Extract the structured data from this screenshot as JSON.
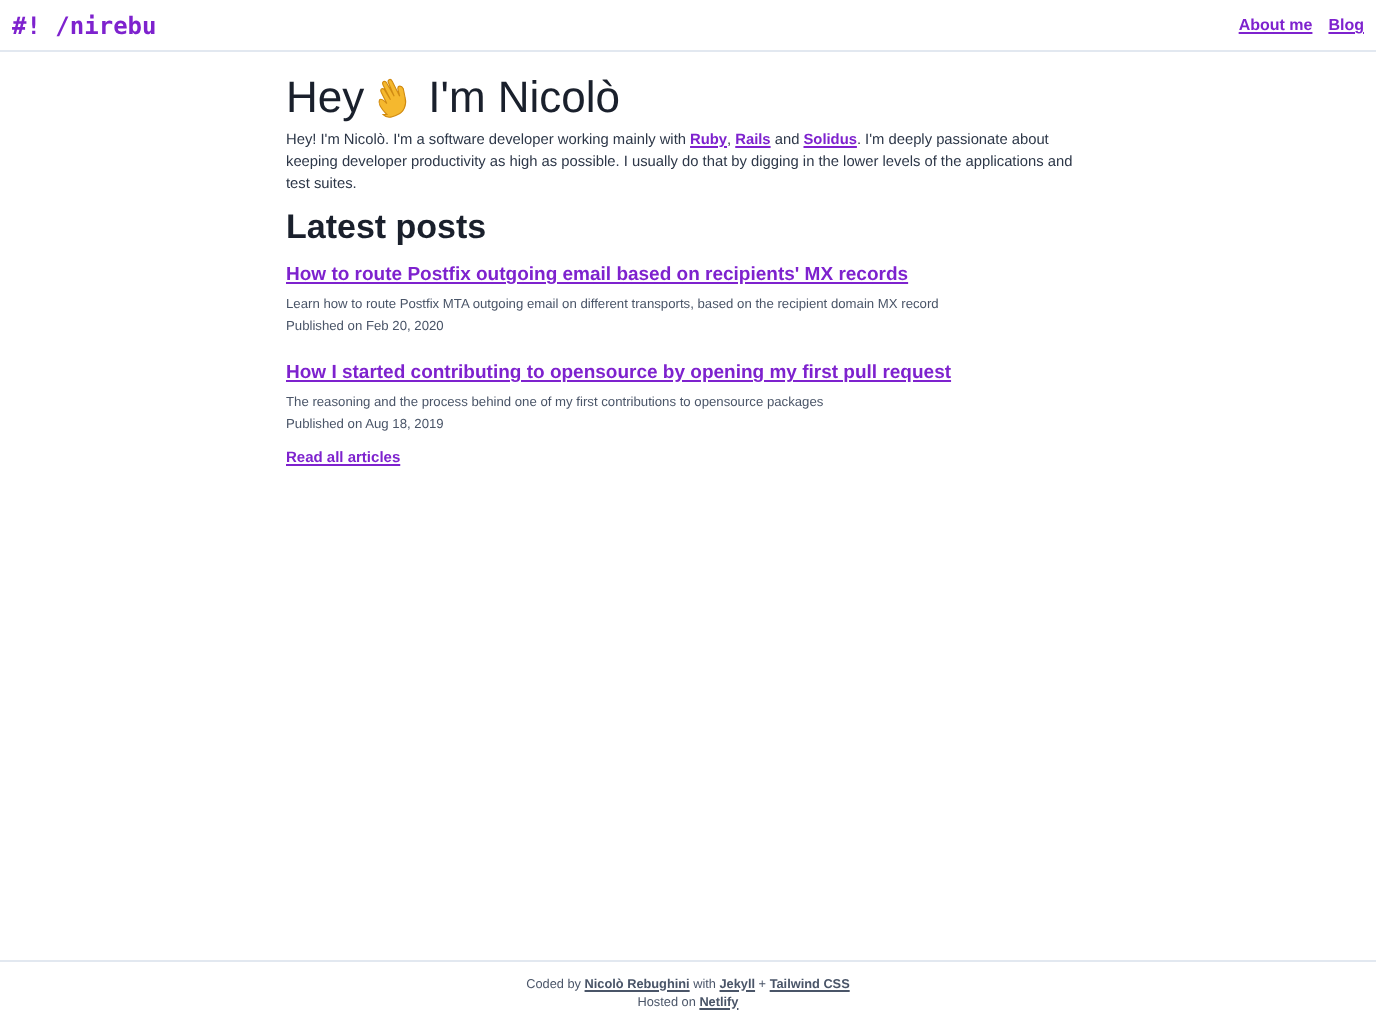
{
  "header": {
    "logo": "#! /nirebu",
    "nav": [
      "About me",
      "Blog"
    ]
  },
  "hero": {
    "title_before": "Hey",
    "title_after": "I'm Nicolò",
    "intro": [
      {
        "kind": "text",
        "text": "Hey! I'm Nicolò. I'm a software developer working mainly with "
      },
      {
        "kind": "link",
        "text": "Ruby"
      },
      {
        "kind": "text",
        "text": ", "
      },
      {
        "kind": "link",
        "text": "Rails"
      },
      {
        "kind": "text",
        "text": " and "
      },
      {
        "kind": "link",
        "text": "Solidus"
      },
      {
        "kind": "text",
        "text": ". I'm deeply passionate about keeping developer productivity as high as possible. I usually do that by digging in the lower levels of the applications and test suites."
      }
    ]
  },
  "latest_posts": {
    "title": "Latest posts",
    "posts": [
      {
        "title": "How to route Postfix outgoing email based on recipients' MX records",
        "summary": "Learn how to route Postfix MTA outgoing email on different transports, based on the recipient domain MX record",
        "published": "Published on Feb 20, 2020"
      },
      {
        "title": "How I started contributing to opensource by opening my first pull request",
        "summary": "The reasoning and the process behind one of my first contributions to opensource packages",
        "published": "Published on Aug 18, 2019"
      }
    ],
    "read_all": "Read all articles"
  },
  "footer": {
    "lines": [
      [
        {
          "kind": "text",
          "text": "Coded by "
        },
        {
          "kind": "link",
          "text": "Nicolò Rebughini"
        },
        {
          "kind": "text",
          "text": " with "
        },
        {
          "kind": "link",
          "text": "Jekyll"
        },
        {
          "kind": "text",
          "text": " + "
        },
        {
          "kind": "link",
          "text": "Tailwind CSS"
        }
      ],
      [
        {
          "kind": "text",
          "text": "Hosted on "
        },
        {
          "kind": "link",
          "text": "Netlify"
        }
      ]
    ]
  }
}
